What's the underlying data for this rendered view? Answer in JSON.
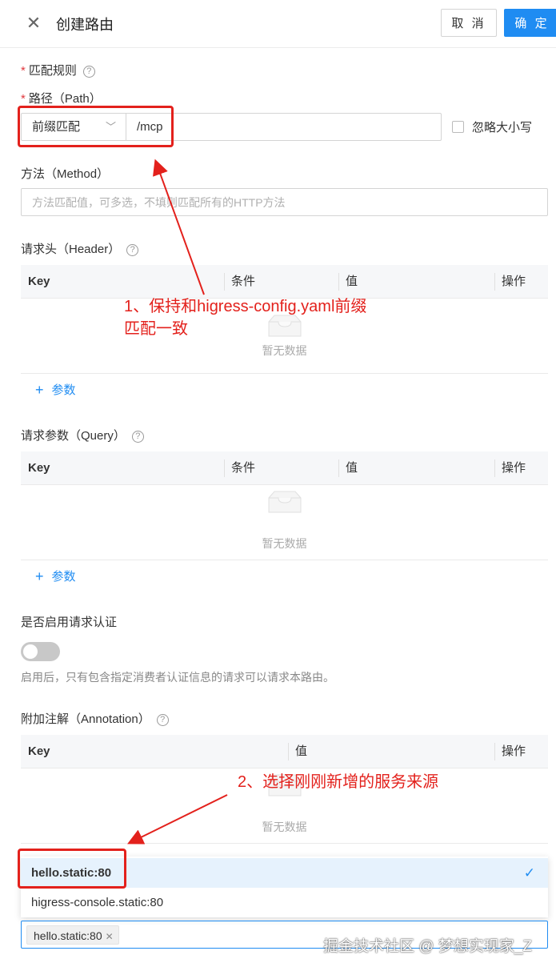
{
  "header": {
    "title": "创建路由",
    "cancel_label": "取 消",
    "ok_label": "确 定"
  },
  "match_rule": {
    "label": "匹配规则"
  },
  "path": {
    "label": "路径（Path）",
    "match_type": "前缀匹配",
    "value": "/mcp",
    "ignore_case_label": "忽略大小写"
  },
  "method": {
    "label": "方法（Method）",
    "placeholder": "方法匹配值，可多选，不填则匹配所有的HTTP方法"
  },
  "header_table": {
    "label": "请求头（Header）",
    "columns": [
      "Key",
      "条件",
      "值",
      "操作"
    ],
    "empty_text": "暂无数据",
    "add_label": "参数"
  },
  "query_table": {
    "label": "请求参数（Query）",
    "columns": [
      "Key",
      "条件",
      "值",
      "操作"
    ],
    "empty_text": "暂无数据",
    "add_label": "参数"
  },
  "auth": {
    "label": "是否启用请求认证",
    "enabled": false,
    "hint": "启用后，只有包含指定消费者认证信息的请求可以请求本路由。"
  },
  "annotation_table": {
    "label": "附加注解（Annotation）",
    "columns": [
      "Key",
      "值",
      "操作"
    ],
    "empty_text": "暂无数据"
  },
  "service_dropdown": {
    "options": [
      "hello.static:80",
      "higress-console.static:80"
    ],
    "selected": "hello.static:80"
  },
  "service_input": {
    "tag": "hello.static:80"
  },
  "annotations": {
    "note1_line1": "1、保持和higress-config.yaml前缀",
    "note1_line2": "匹配一致",
    "note2": "2、选择刚刚新增的服务来源",
    "color": "#e3211c"
  },
  "watermark": "掘金技术社区 @ 梦想实现家_Z",
  "colors": {
    "primary": "#1f8cf2",
    "required": "#e0393e"
  }
}
